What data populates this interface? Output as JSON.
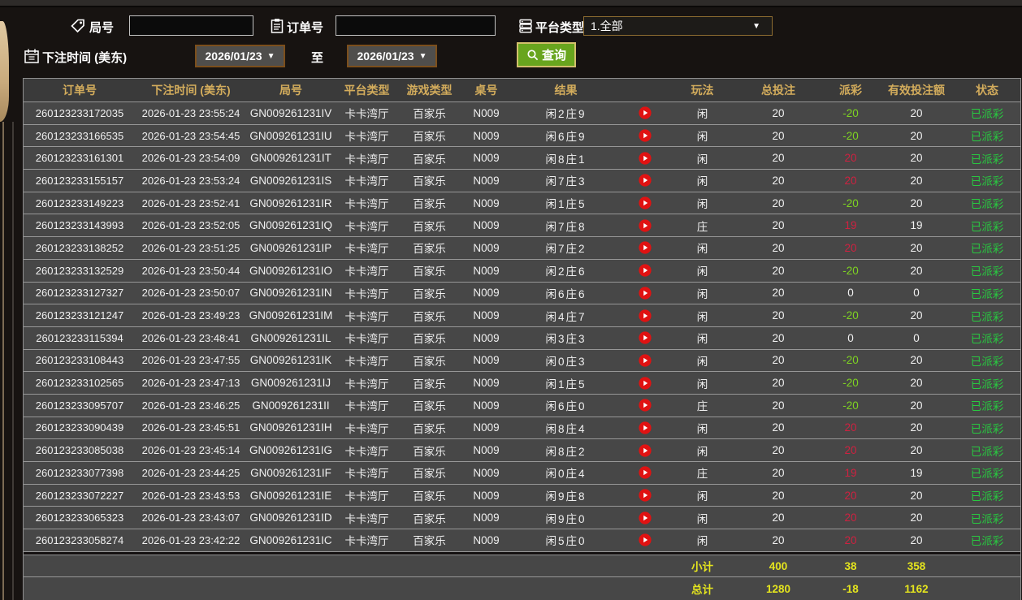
{
  "filters": {
    "round_label": "局号",
    "round_value": "",
    "order_label": "订单号",
    "order_value": "",
    "platform_label": "平台类型",
    "platform_value": "1.全部",
    "bet_time_label": "下注时间 (美东)",
    "date_from": "2026/01/23",
    "to_label": "至",
    "date_to": "2026/01/23",
    "search_label": "查询"
  },
  "colors": {
    "bg_dark": "#171311",
    "accent_gold": "#d3ac5c",
    "win_red": "#cf2140",
    "loss_green": "#7ed321",
    "paid_green": "#28c940",
    "total_yellow": "#e4e41e",
    "button_green": "#68a51e"
  },
  "table": {
    "headers": [
      "订单号",
      "下注时间 (美东)",
      "局号",
      "平台类型",
      "游戏类型",
      "桌号",
      "结果",
      "玩法",
      "总投注",
      "派彩",
      "有效投注额",
      "状态"
    ],
    "rows": [
      {
        "order_no": "260123233172035",
        "bet_time": "2026-01-23 23:55:24",
        "round_no": "GN009261231IV",
        "platform": "卡卡湾厅",
        "game_type": "百家乐",
        "table_no": "N009",
        "result": "闲2庄9",
        "play_method": "闲",
        "total_bet": "20",
        "payout": "-20",
        "valid_bet": "20",
        "status": "已派彩"
      },
      {
        "order_no": "260123233166535",
        "bet_time": "2026-01-23 23:54:45",
        "round_no": "GN009261231IU",
        "platform": "卡卡湾厅",
        "game_type": "百家乐",
        "table_no": "N009",
        "result": "闲6庄9",
        "play_method": "闲",
        "total_bet": "20",
        "payout": "-20",
        "valid_bet": "20",
        "status": "已派彩"
      },
      {
        "order_no": "260123233161301",
        "bet_time": "2026-01-23 23:54:09",
        "round_no": "GN009261231IT",
        "platform": "卡卡湾厅",
        "game_type": "百家乐",
        "table_no": "N009",
        "result": "闲8庄1",
        "play_method": "闲",
        "total_bet": "20",
        "payout": "20",
        "valid_bet": "20",
        "status": "已派彩"
      },
      {
        "order_no": "260123233155157",
        "bet_time": "2026-01-23 23:53:24",
        "round_no": "GN009261231IS",
        "platform": "卡卡湾厅",
        "game_type": "百家乐",
        "table_no": "N009",
        "result": "闲7庄3",
        "play_method": "闲",
        "total_bet": "20",
        "payout": "20",
        "valid_bet": "20",
        "status": "已派彩"
      },
      {
        "order_no": "260123233149223",
        "bet_time": "2026-01-23 23:52:41",
        "round_no": "GN009261231IR",
        "platform": "卡卡湾厅",
        "game_type": "百家乐",
        "table_no": "N009",
        "result": "闲1庄5",
        "play_method": "闲",
        "total_bet": "20",
        "payout": "-20",
        "valid_bet": "20",
        "status": "已派彩"
      },
      {
        "order_no": "260123233143993",
        "bet_time": "2026-01-23 23:52:05",
        "round_no": "GN009261231IQ",
        "platform": "卡卡湾厅",
        "game_type": "百家乐",
        "table_no": "N009",
        "result": "闲7庄8",
        "play_method": "庄",
        "total_bet": "20",
        "payout": "19",
        "valid_bet": "19",
        "status": "已派彩"
      },
      {
        "order_no": "260123233138252",
        "bet_time": "2026-01-23 23:51:25",
        "round_no": "GN009261231IP",
        "platform": "卡卡湾厅",
        "game_type": "百家乐",
        "table_no": "N009",
        "result": "闲7庄2",
        "play_method": "闲",
        "total_bet": "20",
        "payout": "20",
        "valid_bet": "20",
        "status": "已派彩"
      },
      {
        "order_no": "260123233132529",
        "bet_time": "2026-01-23 23:50:44",
        "round_no": "GN009261231IO",
        "platform": "卡卡湾厅",
        "game_type": "百家乐",
        "table_no": "N009",
        "result": "闲2庄6",
        "play_method": "闲",
        "total_bet": "20",
        "payout": "-20",
        "valid_bet": "20",
        "status": "已派彩"
      },
      {
        "order_no": "260123233127327",
        "bet_time": "2026-01-23 23:50:07",
        "round_no": "GN009261231IN",
        "platform": "卡卡湾厅",
        "game_type": "百家乐",
        "table_no": "N009",
        "result": "闲6庄6",
        "play_method": "闲",
        "total_bet": "20",
        "payout": "0",
        "valid_bet": "0",
        "status": "已派彩"
      },
      {
        "order_no": "260123233121247",
        "bet_time": "2026-01-23 23:49:23",
        "round_no": "GN009261231IM",
        "platform": "卡卡湾厅",
        "game_type": "百家乐",
        "table_no": "N009",
        "result": "闲4庄7",
        "play_method": "闲",
        "total_bet": "20",
        "payout": "-20",
        "valid_bet": "20",
        "status": "已派彩"
      },
      {
        "order_no": "260123233115394",
        "bet_time": "2026-01-23 23:48:41",
        "round_no": "GN009261231IL",
        "platform": "卡卡湾厅",
        "game_type": "百家乐",
        "table_no": "N009",
        "result": "闲3庄3",
        "play_method": "闲",
        "total_bet": "20",
        "payout": "0",
        "valid_bet": "0",
        "status": "已派彩"
      },
      {
        "order_no": "260123233108443",
        "bet_time": "2026-01-23 23:47:55",
        "round_no": "GN009261231IK",
        "platform": "卡卡湾厅",
        "game_type": "百家乐",
        "table_no": "N009",
        "result": "闲0庄3",
        "play_method": "闲",
        "total_bet": "20",
        "payout": "-20",
        "valid_bet": "20",
        "status": "已派彩"
      },
      {
        "order_no": "260123233102565",
        "bet_time": "2026-01-23 23:47:13",
        "round_no": "GN009261231IJ",
        "platform": "卡卡湾厅",
        "game_type": "百家乐",
        "table_no": "N009",
        "result": "闲1庄5",
        "play_method": "闲",
        "total_bet": "20",
        "payout": "-20",
        "valid_bet": "20",
        "status": "已派彩"
      },
      {
        "order_no": "260123233095707",
        "bet_time": "2026-01-23 23:46:25",
        "round_no": "GN009261231II",
        "platform": "卡卡湾厅",
        "game_type": "百家乐",
        "table_no": "N009",
        "result": "闲6庄0",
        "play_method": "庄",
        "total_bet": "20",
        "payout": "-20",
        "valid_bet": "20",
        "status": "已派彩"
      },
      {
        "order_no": "260123233090439",
        "bet_time": "2026-01-23 23:45:51",
        "round_no": "GN009261231IH",
        "platform": "卡卡湾厅",
        "game_type": "百家乐",
        "table_no": "N009",
        "result": "闲8庄4",
        "play_method": "闲",
        "total_bet": "20",
        "payout": "20",
        "valid_bet": "20",
        "status": "已派彩"
      },
      {
        "order_no": "260123233085038",
        "bet_time": "2026-01-23 23:45:14",
        "round_no": "GN009261231IG",
        "platform": "卡卡湾厅",
        "game_type": "百家乐",
        "table_no": "N009",
        "result": "闲8庄2",
        "play_method": "闲",
        "total_bet": "20",
        "payout": "20",
        "valid_bet": "20",
        "status": "已派彩"
      },
      {
        "order_no": "260123233077398",
        "bet_time": "2026-01-23 23:44:25",
        "round_no": "GN009261231IF",
        "platform": "卡卡湾厅",
        "game_type": "百家乐",
        "table_no": "N009",
        "result": "闲0庄4",
        "play_method": "庄",
        "total_bet": "20",
        "payout": "19",
        "valid_bet": "19",
        "status": "已派彩"
      },
      {
        "order_no": "260123233072227",
        "bet_time": "2026-01-23 23:43:53",
        "round_no": "GN009261231IE",
        "platform": "卡卡湾厅",
        "game_type": "百家乐",
        "table_no": "N009",
        "result": "闲9庄8",
        "play_method": "闲",
        "total_bet": "20",
        "payout": "20",
        "valid_bet": "20",
        "status": "已派彩"
      },
      {
        "order_no": "260123233065323",
        "bet_time": "2026-01-23 23:43:07",
        "round_no": "GN009261231ID",
        "platform": "卡卡湾厅",
        "game_type": "百家乐",
        "table_no": "N009",
        "result": "闲9庄0",
        "play_method": "闲",
        "total_bet": "20",
        "payout": "20",
        "valid_bet": "20",
        "status": "已派彩"
      },
      {
        "order_no": "260123233058274",
        "bet_time": "2026-01-23 23:42:22",
        "round_no": "GN009261231IC",
        "platform": "卡卡湾厅",
        "game_type": "百家乐",
        "table_no": "N009",
        "result": "闲5庄0",
        "play_method": "闲",
        "total_bet": "20",
        "payout": "20",
        "valid_bet": "20",
        "status": "已派彩"
      }
    ],
    "subtotal": {
      "label": "小计",
      "total_bet": "400",
      "payout": "38",
      "valid_bet": "358"
    },
    "grand_total": {
      "label": "总计",
      "total_bet": "1280",
      "payout": "-18",
      "valid_bet": "1162"
    }
  }
}
